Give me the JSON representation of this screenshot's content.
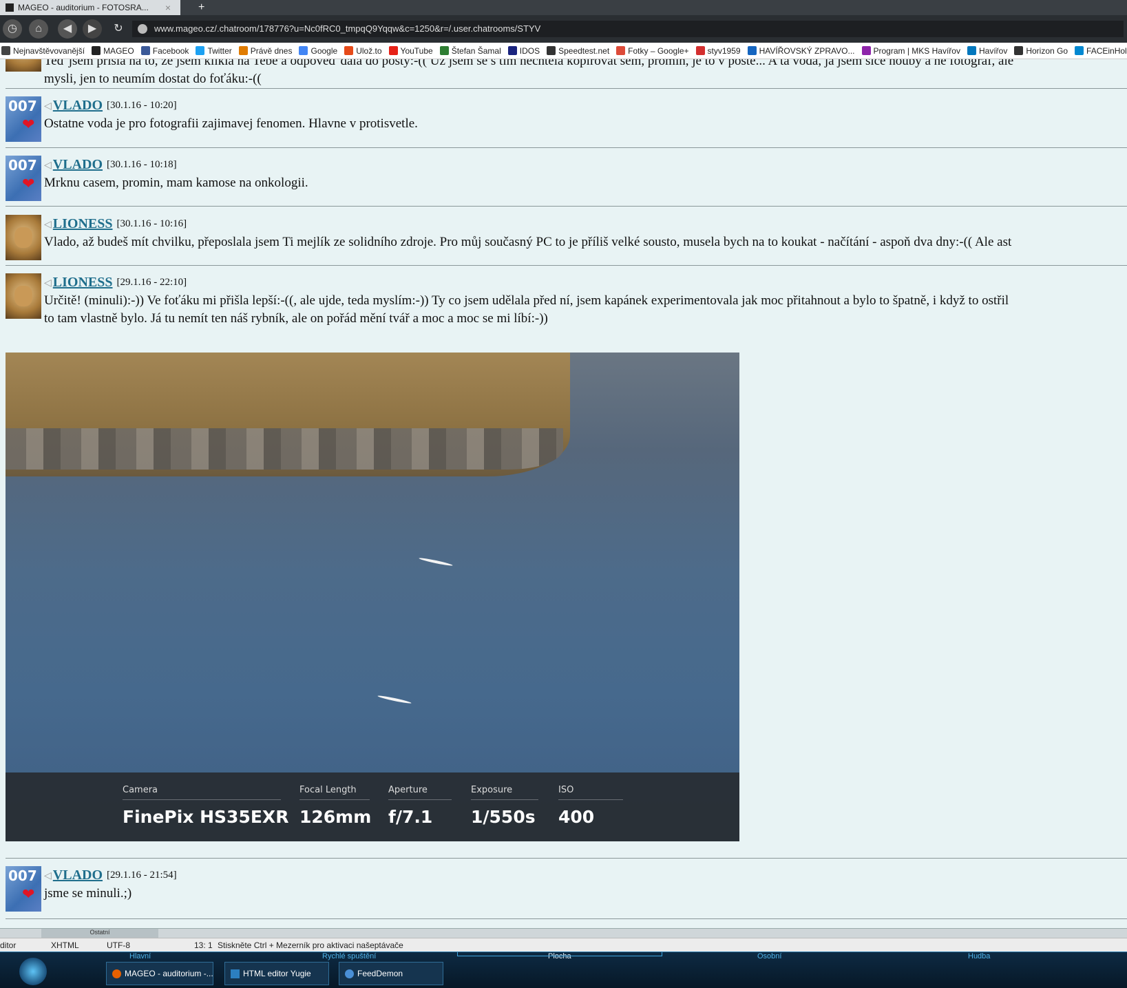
{
  "browser": {
    "tab_title": "MAGEO - auditorium - FOTOSRA...",
    "tab_close": "×",
    "new_tab": "+",
    "url": "www.mageo.cz/.chatroom/178776?u=Nc0fRC0_tmpqQ9Yqqw&c=1250&r=/.user.chatrooms/STYV",
    "bookmarks": [
      {
        "label": "Nejnavštěvovanější",
        "color": "#444444"
      },
      {
        "label": "MAGEO",
        "color": "#222222"
      },
      {
        "label": "Facebook",
        "color": "#3b5998"
      },
      {
        "label": "Twitter",
        "color": "#1da1f2"
      },
      {
        "label": "Právě dnes",
        "color": "#e07b00"
      },
      {
        "label": "Google",
        "color": "#4285f4"
      },
      {
        "label": "Ulož.to",
        "color": "#e64a19"
      },
      {
        "label": "YouTube",
        "color": "#e62117"
      },
      {
        "label": "Štefan Šamal",
        "color": "#2e7d32"
      },
      {
        "label": "IDOS",
        "color": "#1a237e"
      },
      {
        "label": "Speedtest.net",
        "color": "#333333"
      },
      {
        "label": "Fotky – Google+",
        "color": "#dd4b39"
      },
      {
        "label": "styv1959",
        "color": "#d32f2f"
      },
      {
        "label": "HAVÍŘOVSKÝ ZPRAVO...",
        "color": "#1565c0"
      },
      {
        "label": "Program | MKS Havířov",
        "color": "#8e24aa"
      },
      {
        "label": "Havířov",
        "color": "#0277bd"
      },
      {
        "label": "Horizon Go",
        "color": "#333333"
      },
      {
        "label": "FACEinHole",
        "color": "#0288d1"
      }
    ]
  },
  "posts": [
    {
      "top_line": "Teď jsem přišla na to, že jsem klikla na Tebe a odpověď dala do pošty:-(( Už jsem se s tím nechtěla kopírovat sem, promiň, je to v poště... A ta voda, já jsem sice houby a né fotograf, ale",
      "lines": [
        "mysli, jen to neumím dostat do foťáku:-(("
      ]
    },
    {
      "author": "VLADO",
      "avatar": "007",
      "heart": "❤",
      "time": "[30.1.16 - 10:20]",
      "lines": [
        "Ostatne voda je pro fotografii zajimavej fenomen. Hlavne v protisvetle."
      ]
    },
    {
      "author": "VLADO",
      "avatar": "007",
      "heart": "❤",
      "time": "[30.1.16 - 10:18]",
      "lines": [
        "Mrknu casem, promin, mam kamose na onkologii."
      ]
    },
    {
      "author": "LIONESS",
      "time": "[30.1.16 - 10:16]",
      "lines": [
        "Vlado, až budeš mít chvilku, přeposlala jsem Ti mejlík ze solidního zdroje. Pro můj současný PC to je příliš velké sousto, musela bych na to koukat - načítání - aspoň dva dny:-(( Ale ast"
      ]
    },
    {
      "author": "LIONESS",
      "time": "[29.1.16 - 22:10]",
      "lines": [
        "Určitě! (minuli):-)) Ve foťáku mi přišla lepší:-((, ale ujde, teda myslím:-)) Ty co jsem udělala před ní, jsem kapánek experimentovala jak moc přitahnout a bylo to špatně, i když to ostřil",
        "to tam vlastně bylo. Já tu nemít ten náš rybník, ale on pořád mění tvář a moc a moc se mi líbí:-))"
      ]
    },
    {
      "author": "VLADO",
      "avatar": "007",
      "heart": "❤",
      "time": "[29.1.16 - 21:54]",
      "lines": [
        "jsme se minuli.;)"
      ]
    }
  ],
  "exif": {
    "camera_label": "Camera",
    "camera": "FinePix HS35EXR",
    "focal_label": "Focal Length",
    "focal": "126mm",
    "aperture_label": "Aperture",
    "aperture": "f/7.1",
    "exposure_label": "Exposure",
    "exposure": "1/550s",
    "iso_label": "ISO",
    "iso": "400"
  },
  "editor": {
    "tab": "Ostatní",
    "status_editor": "ditor",
    "status_doctype": "XHTML",
    "status_encoding": "UTF-8",
    "status_position": "13:  1",
    "status_hint": "Stiskněte Ctrl + Mezerník pro aktivaci našeptávače"
  },
  "taskbar": {
    "menus": [
      "Hlavní",
      "Rychlé spuštění",
      "Plocha",
      "Osobní",
      "Hudba"
    ],
    "buttons": [
      "MAGEO - auditorium -...",
      "HTML editor Yugie",
      "FeedDemon"
    ]
  }
}
